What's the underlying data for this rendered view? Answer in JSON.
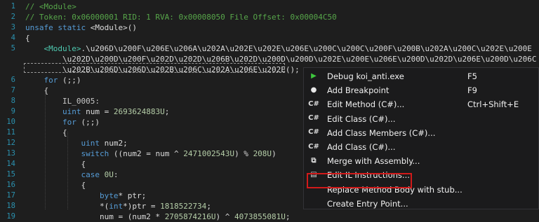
{
  "code_lines": [
    {
      "num": "1",
      "tokens": [
        {
          "c": "cm",
          "t": "// <Module>"
        }
      ]
    },
    {
      "num": "2",
      "tokens": [
        {
          "c": "cm",
          "t": "// Token: 0x06000001 RID: 1 RVA: 0x00008050 File Offset: 0x00004C50"
        }
      ]
    },
    {
      "num": "3",
      "tokens": [
        {
          "c": "kw",
          "t": "unsafe static "
        },
        {
          "c": "tx",
          "t": "<Module>()"
        }
      ]
    },
    {
      "num": "4",
      "tokens": [
        {
          "c": "tx",
          "t": "{"
        }
      ]
    },
    {
      "num": "5",
      "tokens": [
        {
          "c": "tx",
          "t": "    "
        },
        {
          "c": "ty",
          "t": "<Module>"
        },
        {
          "c": "tx",
          "t": ".\\u206D\\u200F\\u206E\\u206A\\u202A\\u202E\\u202E\\u206E\\u200C\\u200C\\u200F\\u200B\\u202A\\u200C\\u202E\\u200E"
        }
      ]
    },
    {
      "num": "",
      "tokens": [
        {
          "c": "tx",
          "t": "        \\u202D\\u200D\\u200F\\u202D\\u202D\\u206B\\u202D\\u200D\\u200D\\u202E\\u200E\\u206E\\u200D\\u202D\\u206E\\u200D\\u206C"
        }
      ]
    },
    {
      "num": "",
      "tokens": [
        {
          "c": "tx",
          "t": "        \\u202B\\u206D\\u206D\\u202B\\u206C\\u202A\\u206E\\u202E();"
        }
      ]
    },
    {
      "num": "6",
      "tokens": [
        {
          "c": "tx",
          "t": "    "
        },
        {
          "c": "kw",
          "t": "for"
        },
        {
          "c": "tx",
          "t": " (;;)"
        }
      ]
    },
    {
      "num": "7",
      "tokens": [
        {
          "c": "tx",
          "t": "    {"
        }
      ]
    },
    {
      "num": "8",
      "tokens": [
        {
          "c": "lb",
          "t": "        IL_0005:"
        }
      ]
    },
    {
      "num": "9",
      "tokens": [
        {
          "c": "tx",
          "t": "        "
        },
        {
          "c": "kw",
          "t": "uint"
        },
        {
          "c": "tx",
          "t": " num = "
        },
        {
          "c": "nm",
          "t": "2693624883U"
        },
        {
          "c": "tx",
          "t": ";"
        }
      ]
    },
    {
      "num": "10",
      "tokens": [
        {
          "c": "tx",
          "t": "        "
        },
        {
          "c": "kw",
          "t": "for"
        },
        {
          "c": "tx",
          "t": " (;;)"
        }
      ]
    },
    {
      "num": "11",
      "tokens": [
        {
          "c": "tx",
          "t": "        {"
        }
      ]
    },
    {
      "num": "12",
      "tokens": [
        {
          "c": "tx",
          "t": "            "
        },
        {
          "c": "kw",
          "t": "uint"
        },
        {
          "c": "tx",
          "t": " num2;"
        }
      ]
    },
    {
      "num": "13",
      "tokens": [
        {
          "c": "tx",
          "t": "            "
        },
        {
          "c": "kw",
          "t": "switch"
        },
        {
          "c": "tx",
          "t": " ((num2 = num ^ "
        },
        {
          "c": "nm",
          "t": "2471002543U"
        },
        {
          "c": "tx",
          "t": ") % "
        },
        {
          "c": "nm",
          "t": "208U"
        },
        {
          "c": "tx",
          "t": ")"
        }
      ]
    },
    {
      "num": "14",
      "tokens": [
        {
          "c": "tx",
          "t": "            {"
        }
      ]
    },
    {
      "num": "15",
      "tokens": [
        {
          "c": "tx",
          "t": "            "
        },
        {
          "c": "kw",
          "t": "case"
        },
        {
          "c": "tx",
          "t": " "
        },
        {
          "c": "nm",
          "t": "0U"
        },
        {
          "c": "tx",
          "t": ":"
        }
      ]
    },
    {
      "num": "16",
      "tokens": [
        {
          "c": "tx",
          "t": "            {"
        }
      ]
    },
    {
      "num": "17",
      "tokens": [
        {
          "c": "tx",
          "t": "                "
        },
        {
          "c": "kw",
          "t": "byte"
        },
        {
          "c": "tx",
          "t": "* ptr;"
        }
      ]
    },
    {
      "num": "18",
      "tokens": [
        {
          "c": "tx",
          "t": "                *("
        },
        {
          "c": "kw",
          "t": "int"
        },
        {
          "c": "tx",
          "t": "*)ptr = "
        },
        {
          "c": "nm",
          "t": "1818522734"
        },
        {
          "c": "tx",
          "t": ";"
        }
      ]
    },
    {
      "num": "19",
      "tokens": [
        {
          "c": "tx",
          "t": "                num = (num2 * "
        },
        {
          "c": "nm",
          "t": "2705874216U"
        },
        {
          "c": "tx",
          "t": ") ^ "
        },
        {
          "c": "nm",
          "t": "4073855081U"
        },
        {
          "c": "tx",
          "t": ";"
        }
      ]
    }
  ],
  "context_menu": [
    {
      "icon": "debug-play-icon",
      "glyph": "▶",
      "color": "#3ec73e",
      "label": "Debug koi_anti.exe",
      "shortcut": "F5"
    },
    {
      "icon": "breakpoint-icon",
      "glyph": "●",
      "color": "#e8e8e8",
      "label": "Add Breakpoint",
      "shortcut": "F9"
    },
    {
      "icon": "csharp-icon",
      "glyph": "C#",
      "color": "#dcdcdc",
      "label": "Edit Method (C#)...",
      "shortcut": "Ctrl+Shift+E"
    },
    {
      "icon": "csharp-icon",
      "glyph": "C#",
      "color": "#dcdcdc",
      "label": "Edit Class (C#)...",
      "shortcut": ""
    },
    {
      "icon": "csharp-icon",
      "glyph": "C#",
      "color": "#dcdcdc",
      "label": "Add Class Members (C#)...",
      "shortcut": ""
    },
    {
      "icon": "csharp-icon",
      "glyph": "C#",
      "color": "#dcdcdc",
      "label": "Add Class (C#)...",
      "shortcut": ""
    },
    {
      "icon": "merge-icon",
      "glyph": "⧉",
      "color": "#dcdcdc",
      "label": "Merge with Assembly...",
      "shortcut": ""
    },
    {
      "icon": "il-document-icon",
      "glyph": "▤",
      "color": "#dcdcdc",
      "label": "Edit IL Instructions...",
      "shortcut": ""
    },
    {
      "icon": "",
      "glyph": "",
      "color": "#dcdcdc",
      "label": "Replace Method Body with stub...",
      "shortcut": ""
    },
    {
      "icon": "",
      "glyph": "",
      "color": "#dcdcdc",
      "label": "Create Entry Point...",
      "shortcut": ""
    }
  ]
}
